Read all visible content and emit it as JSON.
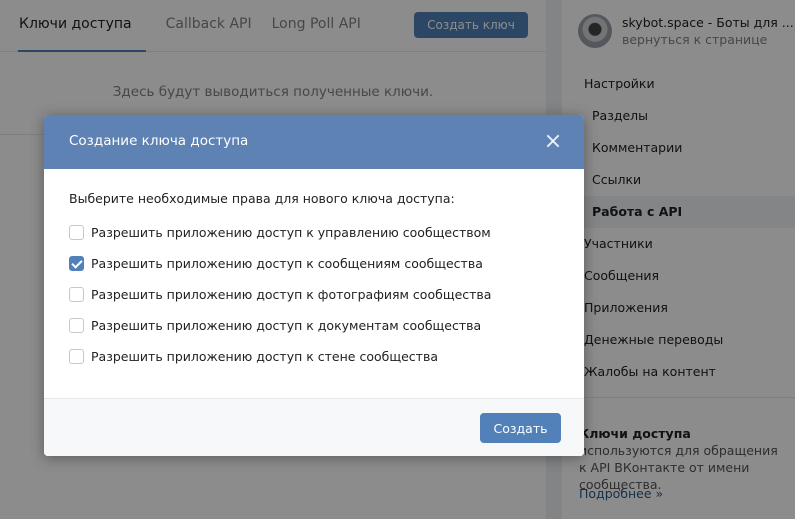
{
  "main": {
    "tabs": [
      {
        "label": "Ключи доступа"
      },
      {
        "label": "Callback API"
      },
      {
        "label": "Long Poll API"
      }
    ],
    "create_key_label": "Создать ключ",
    "empty_text": "Здесь будут выводиться полученные ключи."
  },
  "sidebar": {
    "group_name": "skybot.space - Боты для ...",
    "back_link": "вернуться к странице",
    "items": [
      {
        "label": "Настройки"
      },
      {
        "label": "Разделы"
      },
      {
        "label": "Комментарии"
      },
      {
        "label": "Ссылки"
      },
      {
        "label": "Работа с API"
      },
      {
        "label": "Участники"
      },
      {
        "label": "Сообщения"
      },
      {
        "label": "Приложения"
      },
      {
        "label": "Денежные переводы"
      },
      {
        "label": "Жалобы на контент"
      }
    ],
    "info_bold": "Ключи доступа",
    "info_text": " используются для обращения к API ВКонтакте от имени сообщества.",
    "more_link": "Подробнее »"
  },
  "modal": {
    "title": "Создание ключа доступа",
    "prompt": "Выберите необходимые права для нового ключа доступа:",
    "permissions": [
      {
        "label": "Разрешить приложению доступ к управлению сообществом",
        "checked": false
      },
      {
        "label": "Разрешить приложению доступ к сообщениям сообщества",
        "checked": true
      },
      {
        "label": "Разрешить приложению доступ к фотографиям сообщества",
        "checked": false
      },
      {
        "label": "Разрешить приложению доступ к документам сообщества",
        "checked": false
      },
      {
        "label": "Разрешить приложению доступ к стене сообщества",
        "checked": false
      }
    ],
    "submit_label": "Создать"
  },
  "colors": {
    "accent": "#5181b8",
    "modal_header": "#5d82b3"
  }
}
